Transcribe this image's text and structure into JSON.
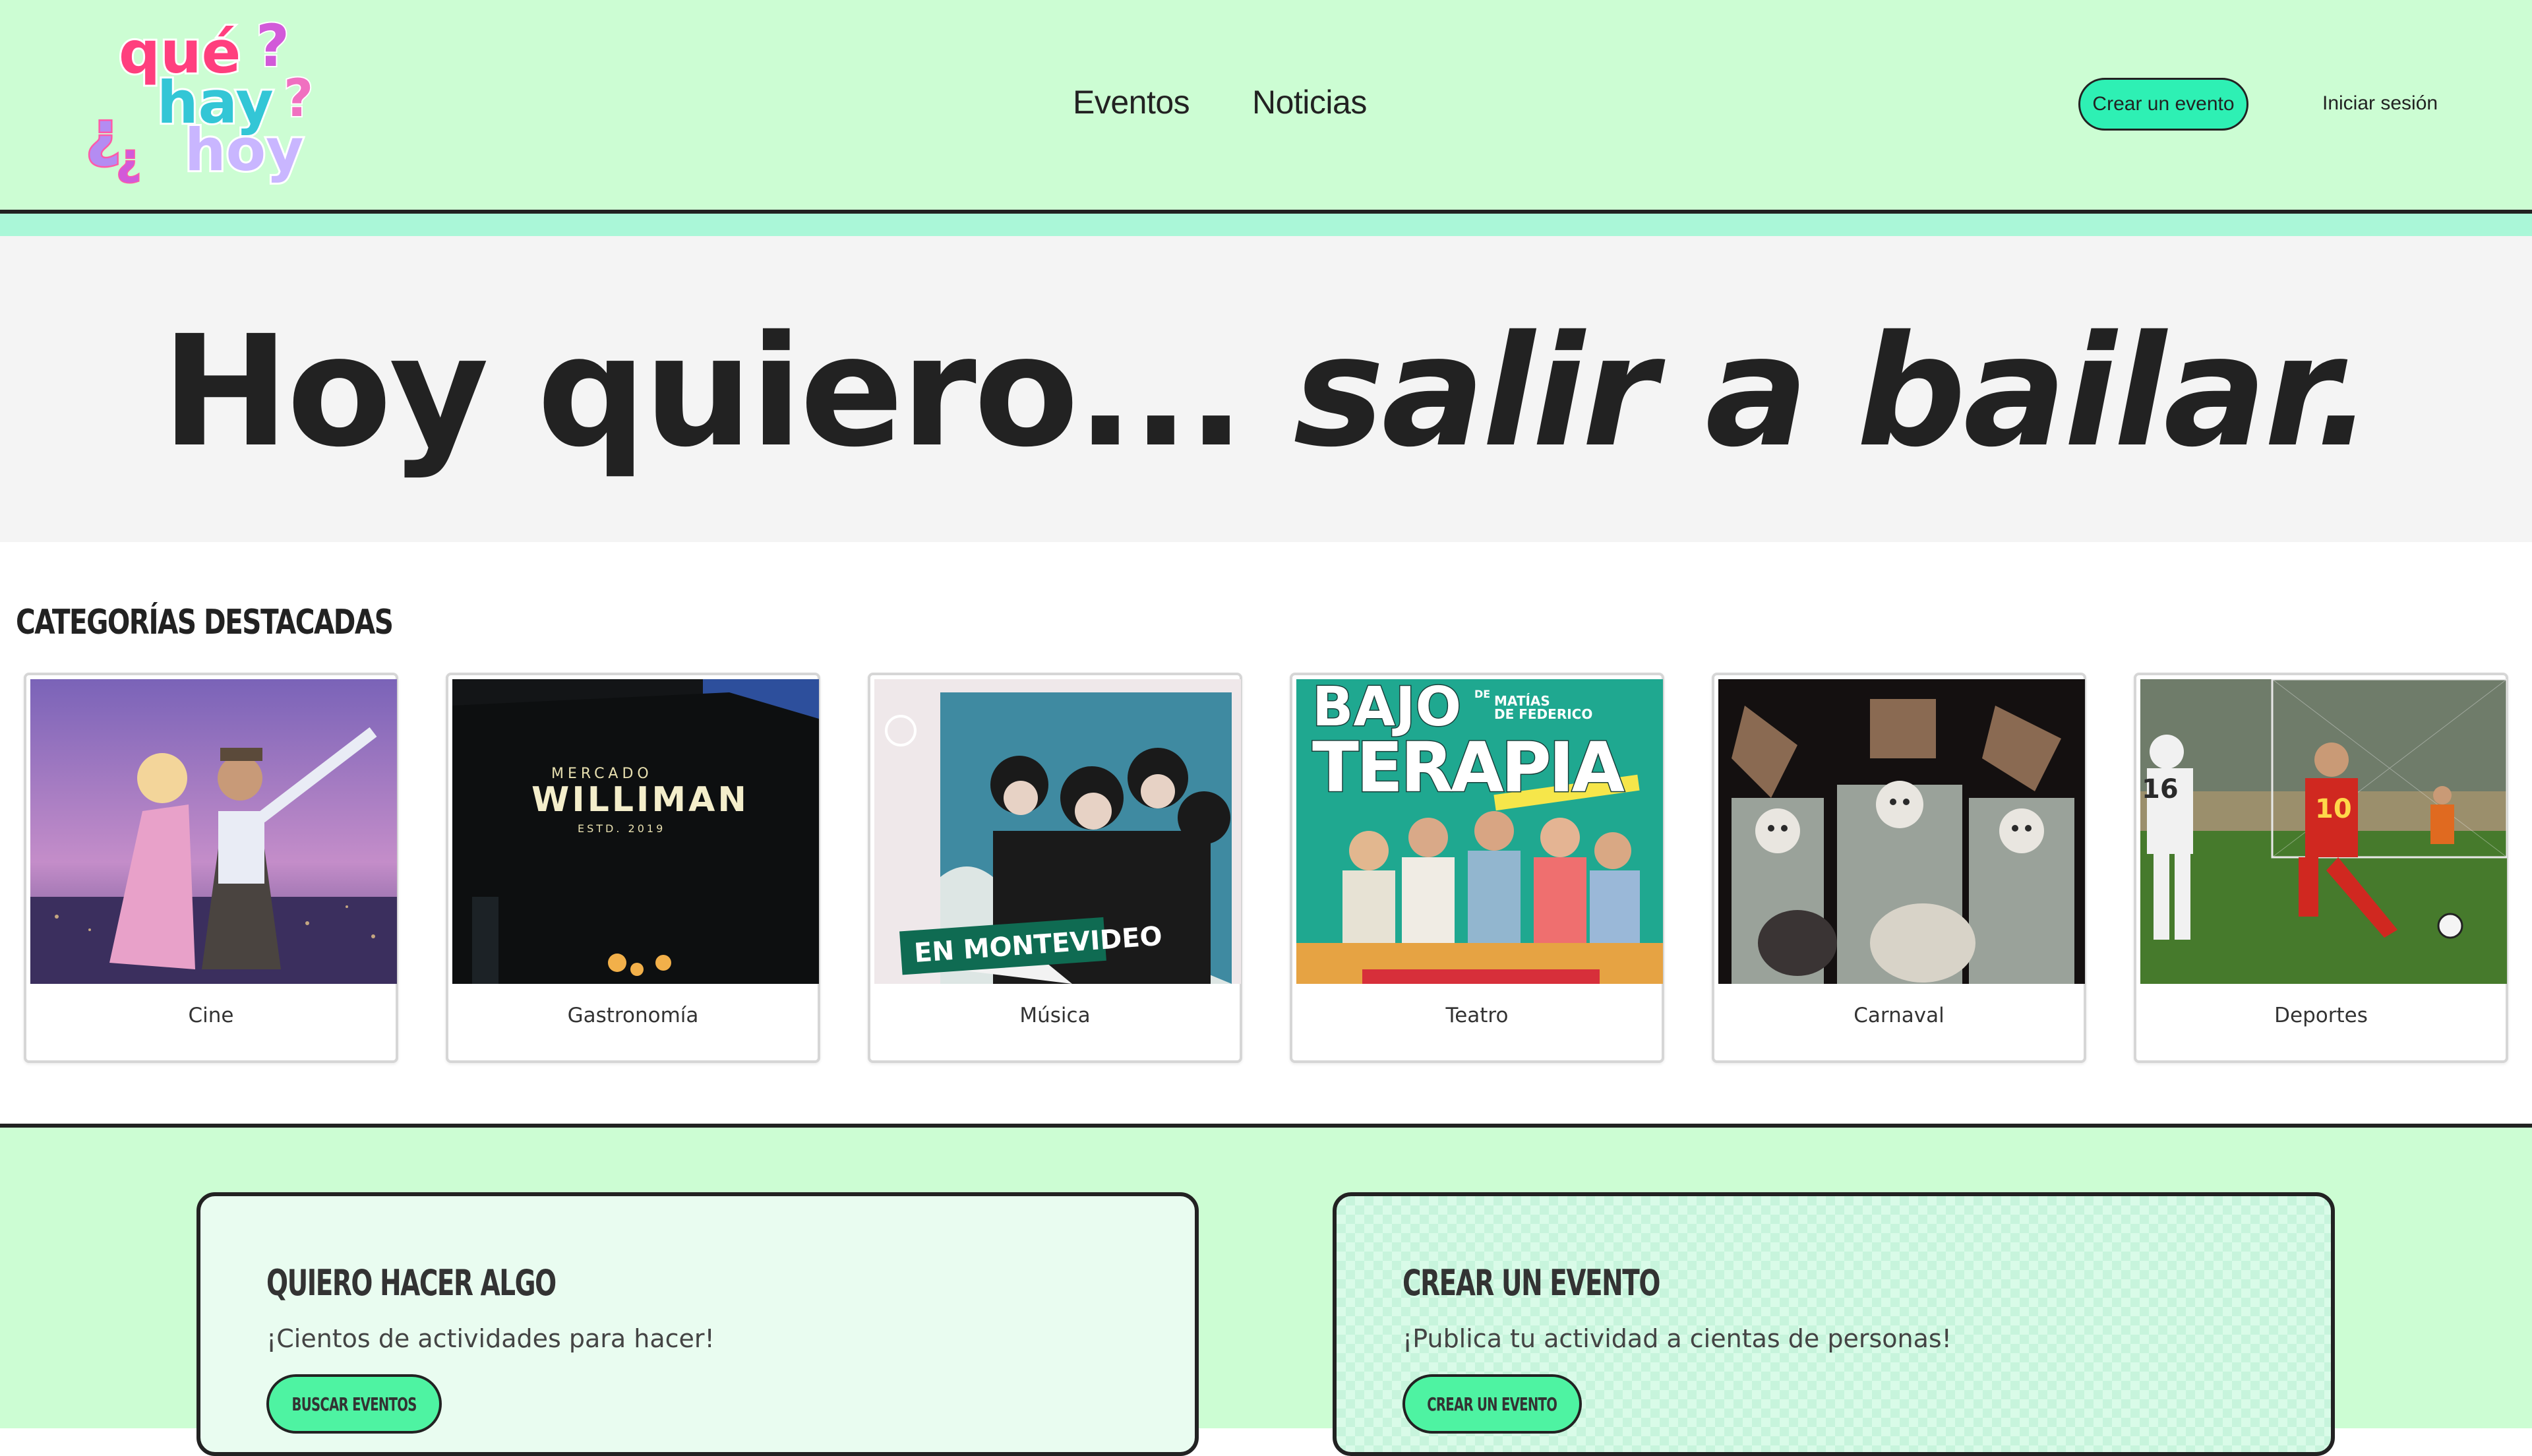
{
  "header": {
    "logo": {
      "line1": "qué",
      "line2": "hay",
      "line3": "hoy",
      "marks": "¿ ?"
    },
    "nav": [
      {
        "label": "Eventos"
      },
      {
        "label": "Noticias"
      }
    ],
    "create_button": "Crear un evento",
    "login_link": "Iniciar sesión",
    "colors": {
      "header_bg": "#ccfdd3",
      "accent": "#2ef0b4",
      "strip": "#aaf7d8"
    }
  },
  "hero": {
    "prefix": "Hoy quiero...",
    "rotating_phrase": "salir a bailar."
  },
  "categories": {
    "title": "CATEGORÍAS DESTACADAS",
    "items": [
      {
        "label": "Cine",
        "image_icon": "dancing-couple-image"
      },
      {
        "label": "Gastronomía",
        "image_icon": "mercado-sign-image",
        "image_text": {
          "top": "MERCADO",
          "main": "WILLIMAN",
          "bottom": "ESTD. 2019"
        }
      },
      {
        "label": "Música",
        "image_icon": "band-poster-image",
        "image_text": {
          "banner": "EN MONTEVIDEO"
        }
      },
      {
        "label": "Teatro",
        "image_icon": "theater-poster-image",
        "image_text": {
          "line1": "BAJO",
          "line2": "TERAPIA",
          "credit1": "DE",
          "credit2": "MATÍAS",
          "credit3": "DE FEDERICO"
        }
      },
      {
        "label": "Carnaval",
        "image_icon": "carnival-performers-image"
      },
      {
        "label": "Deportes",
        "image_icon": "soccer-match-image",
        "image_text": {
          "num1": "16",
          "num2": "10"
        }
      }
    ]
  },
  "panels": [
    {
      "title": "QUIERO HACER ALGO",
      "subtitle": "¡Cientos de actividades para hacer!",
      "button": "BUSCAR EVENTOS"
    },
    {
      "title": "CREAR UN EVENTO",
      "subtitle": "¡Publica tu actividad a cientas de personas!",
      "button": "CREAR UN EVENTO"
    }
  ]
}
